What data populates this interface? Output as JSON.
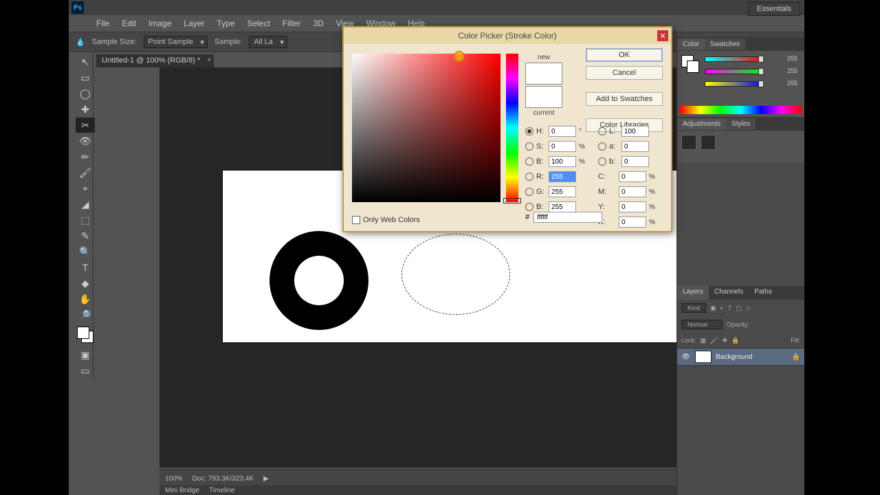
{
  "app_logo": "Ps",
  "menubar": [
    "File",
    "Edit",
    "Image",
    "Layer",
    "Type",
    "Select",
    "Filter",
    "3D",
    "View",
    "Window",
    "Help"
  ],
  "winbtns": {
    "min": "—",
    "max": "□",
    "close": "✕"
  },
  "optionsbar": {
    "sample_size_label": "Sample Size:",
    "sample_size_value": "Point Sample",
    "sample_label": "Sample:",
    "sample_value": "All La"
  },
  "workspace_label": "Essentials",
  "doc_tab": "Untitled-1 @ 100% (RGB/8) *",
  "statusbar": {
    "zoom": "100%",
    "docinfo": "Doc: 793.3K/323.4K",
    "play": "▶"
  },
  "footer_tabs": [
    "Mini Bridge",
    "Timeline"
  ],
  "panels": {
    "color_tabs": [
      "Color",
      "Swatches"
    ],
    "adjust_tabs": [
      "Adjustments",
      "Styles"
    ],
    "layers_tabs": [
      "Layers",
      "Channels",
      "Paths"
    ],
    "layers": {
      "kind_label": "Kind",
      "blend": "Normal",
      "opacity_label": "Opacity:",
      "opacity_value": "",
      "lock_label": "Lock:",
      "fill_label": "Fill:",
      "layer_name": "Background",
      "eye": "👁"
    },
    "slider_vals": [
      "255",
      "255",
      "255"
    ]
  },
  "tools": [
    "↖",
    "▭",
    "◯",
    "✚",
    "✂",
    "👁",
    "✏",
    "🖌",
    "⌖",
    "◢",
    "⬚",
    "✎",
    "🔍",
    "T",
    "◆",
    "✋",
    "🔎"
  ],
  "dialog": {
    "title": "Color Picker (Stroke Color)",
    "close": "✕",
    "new_label": "new",
    "current_label": "current",
    "buttons": {
      "ok": "OK",
      "cancel": "Cancel",
      "add": "Add to Swatches",
      "lib": "Color Libraries"
    },
    "fields": {
      "H": {
        "label": "H:",
        "value": "0",
        "unit": "°"
      },
      "S": {
        "label": "S:",
        "value": "0",
        "unit": "%"
      },
      "Bh": {
        "label": "B:",
        "value": "100",
        "unit": "%"
      },
      "L": {
        "label": "L:",
        "value": "100",
        "unit": ""
      },
      "a": {
        "label": "a:",
        "value": "0",
        "unit": ""
      },
      "b2": {
        "label": "b:",
        "value": "0",
        "unit": ""
      },
      "R": {
        "label": "R:",
        "value": "255",
        "unit": ""
      },
      "G": {
        "label": "G:",
        "value": "255",
        "unit": ""
      },
      "B": {
        "label": "B:",
        "value": "255",
        "unit": ""
      },
      "C": {
        "label": "C:",
        "value": "0",
        "unit": "%"
      },
      "M": {
        "label": "M:",
        "value": "0",
        "unit": "%"
      },
      "Y": {
        "label": "Y:",
        "value": "0",
        "unit": "%"
      },
      "K": {
        "label": "K:",
        "value": "0",
        "unit": "%"
      }
    },
    "hex_label": "#",
    "hex_value": "ffffff",
    "webonly": "Only Web Colors"
  }
}
